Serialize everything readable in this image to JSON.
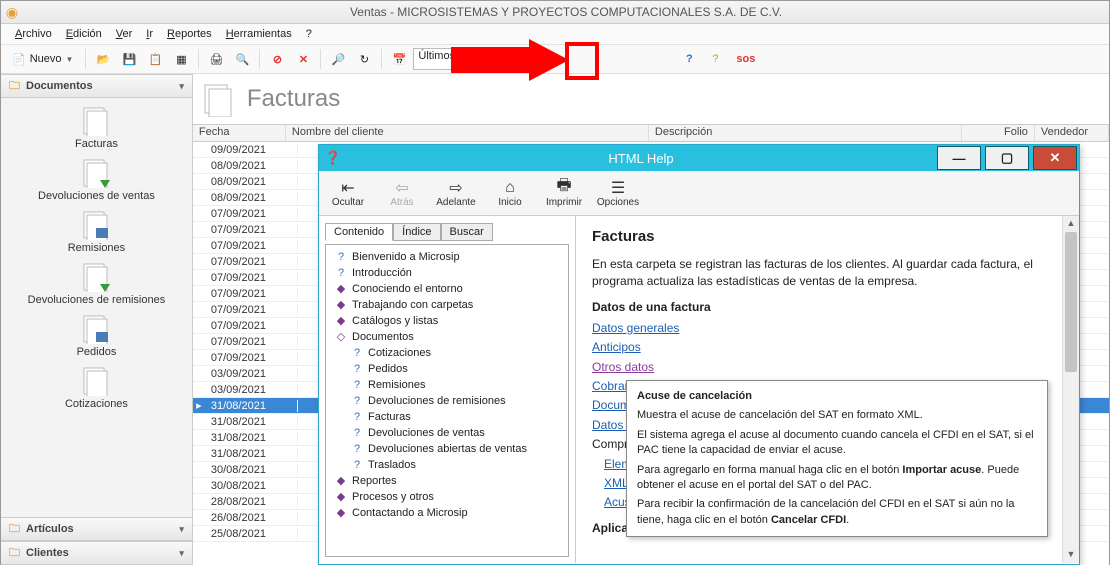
{
  "title": "Ventas - MICROSISTEMAS Y PROYECTOS COMPUTACIONALES S.A. DE C.V.",
  "menu": {
    "archivo": "Archivo",
    "edicion": "Edición",
    "ver": "Ver",
    "ir": "Ir",
    "reportes": "Reportes",
    "herramientas": "Herramientas",
    "ayuda": "?"
  },
  "toolbar": {
    "nuevo": "Nuevo",
    "period": "Últimos 2 m",
    "sos": "sos"
  },
  "sidebar": {
    "documentos": "Documentos",
    "articulos": "Artículos",
    "clientes": "Clientes",
    "items": [
      {
        "label": "Facturas"
      },
      {
        "label": "Devoluciones de ventas"
      },
      {
        "label": "Remisiones"
      },
      {
        "label": "Devoluciones de remisiones"
      },
      {
        "label": "Pedidos"
      },
      {
        "label": "Cotizaciones"
      }
    ]
  },
  "page_heading": "Facturas",
  "grid": {
    "headers": {
      "fecha": "Fecha",
      "nombre": "Nombre del cliente",
      "desc": "Descripción",
      "folio": "Folio",
      "vendedor": "Vendedor"
    },
    "rows": [
      "09/09/2021",
      "08/09/2021",
      "08/09/2021",
      "08/09/2021",
      "07/09/2021",
      "07/09/2021",
      "07/09/2021",
      "07/09/2021",
      "07/09/2021",
      "07/09/2021",
      "07/09/2021",
      "07/09/2021",
      "07/09/2021",
      "07/09/2021",
      "03/09/2021",
      "03/09/2021",
      "31/08/2021",
      "31/08/2021",
      "31/08/2021",
      "31/08/2021",
      "30/08/2021",
      "30/08/2021",
      "28/08/2021",
      "26/08/2021",
      "25/08/2021"
    ],
    "selected_index": 16
  },
  "help": {
    "title": "HTML Help",
    "tb": {
      "ocultar": "Ocultar",
      "atras": "Atrás",
      "adelante": "Adelante",
      "inicio": "Inicio",
      "imprimir": "Imprimir",
      "opciones": "Opciones"
    },
    "tabs": {
      "contenido": "Contenido",
      "indice": "Índice",
      "buscar": "Buscar"
    },
    "tree": [
      {
        "icon": "?",
        "label": "Bienvenido a Microsip"
      },
      {
        "icon": "?",
        "label": "Introducción"
      },
      {
        "icon": "book",
        "label": "Conociendo el entorno"
      },
      {
        "icon": "book",
        "label": "Trabajando con carpetas"
      },
      {
        "icon": "book",
        "label": "Catálogos y listas"
      },
      {
        "icon": "book-open",
        "label": "Documentos"
      },
      {
        "icon": "?",
        "label": "Cotizaciones",
        "indent": 1
      },
      {
        "icon": "?",
        "label": "Pedidos",
        "indent": 1
      },
      {
        "icon": "?",
        "label": "Remisiones",
        "indent": 1
      },
      {
        "icon": "?",
        "label": "Devoluciones de remisiones",
        "indent": 1
      },
      {
        "icon": "?",
        "label": "Facturas",
        "indent": 1
      },
      {
        "icon": "?",
        "label": "Devoluciones de ventas",
        "indent": 1
      },
      {
        "icon": "?",
        "label": "Devoluciones abiertas de ventas",
        "indent": 1
      },
      {
        "icon": "?",
        "label": "Traslados",
        "indent": 1
      },
      {
        "icon": "book",
        "label": "Reportes"
      },
      {
        "icon": "book",
        "label": "Procesos y otros"
      },
      {
        "icon": "book",
        "label": "Contactando a Microsip"
      }
    ],
    "content": {
      "h": "Facturas",
      "p1": "En esta carpeta se registran las facturas de los clientes. Al guardar cada factura, el programa actualiza las estadísticas de ventas de la empresa.",
      "sub1": "Datos de una factura",
      "links": {
        "l1": "Datos generales",
        "l2": "Anticipos",
        "l3": "Otros datos",
        "l4": "Cobranza",
        "l5": "Docume",
        "l6": "Datos p",
        "l7": "Compro",
        "l8": "Eleme",
        "l9": "XML",
        "l10": "Acuse d"
      },
      "sub2": "Aplicac"
    },
    "tooltip": {
      "title": "Acuse de cancelación",
      "p1": "Muestra el acuse de cancelación del SAT en formato XML.",
      "p2_a": "El sistema agrega el acuse al documento cuando cancela el CFDI en el SAT, si el PAC tiene la capacidad de enviar el acuse.",
      "p3_a": "Para agregarlo en forma manual haga clic en el botón ",
      "p3_b": "Importar acuse",
      "p3_c": ". Puede obtener el acuse en el portal del SAT o del PAC.",
      "p4_a": "Para recibir la confirmación de la cancelación del CFDI en el SAT si aún no la tiene, haga clic en el botón ",
      "p4_b": "Cancelar CFDI",
      "p4_c": "."
    }
  }
}
